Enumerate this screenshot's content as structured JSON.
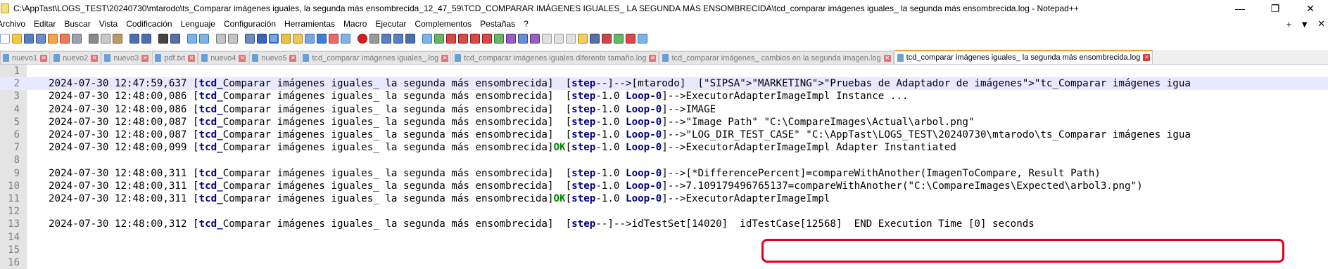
{
  "window": {
    "title": "C:\\AppTast\\LOGS_TEST\\20240730\\mtarodo\\ts_Comparar imágenes iguales, la segunda más ensombrecida_12_47_59\\TCD_COMPARAR IMÁGENES IGUALES_ LA SEGUNDA MÁS ENSOMBRECIDA\\tcd_comparar imágenes iguales_ la segunda más ensombrecida.log - Notepad++",
    "minimize": "—",
    "maximize": "❐",
    "close": "✕"
  },
  "menu": {
    "items": [
      "Archivo",
      "Editar",
      "Buscar",
      "Vista",
      "Codificación",
      "Lenguaje",
      "Configuración",
      "Herramientas",
      "Macro",
      "Ejecutar",
      "Complementos",
      "Pestañas",
      "?"
    ],
    "plus": "+",
    "dropdown": "▼",
    "close": "✕"
  },
  "tabs": [
    {
      "label": "nuevo1",
      "active": false
    },
    {
      "label": "nuevo2",
      "active": false
    },
    {
      "label": "nuevo3",
      "active": false
    },
    {
      "label": "pdf.txt",
      "active": false
    },
    {
      "label": "nuevo4",
      "active": false
    },
    {
      "label": "nuevo5",
      "active": false
    },
    {
      "label": "tcd_comparar imágenes iguales_.log",
      "active": false
    },
    {
      "label": "tcd_comparar imágenes iguales diferente tamaño.log",
      "active": false
    },
    {
      "label": "tcd_comparar imágenes_ cambios en la segunda imagen.log",
      "active": false
    },
    {
      "label": "tcd_comparar imágenes iguales_ la segunda más ensombrecida.log",
      "active": true
    }
  ],
  "editor": {
    "lines": [
      {
        "n": "1",
        "ts": "",
        "tag": "",
        "step": "",
        "rest": ""
      },
      {
        "n": "2",
        "ts": "2024-07-30 12:47:59,637 ",
        "tag": "Comparar imágenes iguales_ la segunda más ensombrecida]  ",
        "step": "--]-->[mtarodo]",
        "loop": "",
        "rest": "  [\"SIPSA\">\"MARKETING\">\"Pruebas de Adaptador de imágenes\">\"tc_Comparar imágenes igua"
      },
      {
        "n": "3",
        "ts": "2024-07-30 12:48:00,086 ",
        "tag": "Comparar imágenes iguales_ la segunda más ensombrecida]  ",
        "step": "-1.0 ",
        "loop": "Loop-0",
        "rest": "]-->ExecutorAdapterImageImpl Instance ..."
      },
      {
        "n": "4",
        "ts": "2024-07-30 12:48:00,086 ",
        "tag": "Comparar imágenes iguales_ la segunda más ensombrecida]  ",
        "step": "-1.0 ",
        "loop": "Loop-0",
        "rest": "]-->IMAGE"
      },
      {
        "n": "5",
        "ts": "2024-07-30 12:48:00,087 ",
        "tag": "Comparar imágenes iguales_ la segunda más ensombrecida]  ",
        "step": "-1.0 ",
        "loop": "Loop-0",
        "rest": "]-->\"Image Path\" \"C:\\CompareImages\\Actual\\arbol.png\""
      },
      {
        "n": "6",
        "ts": "2024-07-30 12:48:00,087 ",
        "tag": "Comparar imágenes iguales_ la segunda más ensombrecida]  ",
        "step": "-1.0 ",
        "loop": "Loop-0",
        "rest": "]-->\"LOG_DIR_TEST_CASE\" \"C:\\AppTast\\LOGS_TEST\\20240730\\mtarodo\\ts_Comparar imágenes igua"
      },
      {
        "n": "7",
        "ts": "2024-07-30 12:48:00,099 ",
        "tag": "Comparar imágenes iguales_ la segunda más ensombrecida]",
        "ok": "OK",
        "step": "-1.0 ",
        "loop": "Loop-0",
        "rest": "]-->ExecutorAdapterImageImpl Adapter Instantiated"
      },
      {
        "n": "8",
        "ts": "",
        "tag": "",
        "step": "",
        "rest": ""
      },
      {
        "n": "9",
        "ts": "2024-07-30 12:48:00,311 ",
        "tag": "Comparar imágenes iguales_ la segunda más ensombrecida]  ",
        "step": "-1.0 ",
        "loop": "Loop-0",
        "rest": "]-->[*DifferencePercent]=compareWithAnother(ImagenToCompare, Result Path)"
      },
      {
        "n": "10",
        "ts": "2024-07-30 12:48:00,311 ",
        "tag": "Comparar imágenes iguales_ la segunda más ensombrecida]  ",
        "step": "-1.0 ",
        "loop": "Loop-0",
        "rest": "]-->7.109179496765137=compareWithAnother(\"C:\\CompareImages\\Expected\\arbol3.png\")"
      },
      {
        "n": "11",
        "ts": "2024-07-30 12:48:00,311 ",
        "tag": "Comparar imágenes iguales_ la segunda más ensombrecida]",
        "ok": "OK",
        "step": "-1.0 ",
        "loop": "Loop-0",
        "rest": "]-->ExecutorAdapterImageImpl"
      },
      {
        "n": "12",
        "ts": "",
        "tag": "",
        "step": "",
        "rest": ""
      },
      {
        "n": "13",
        "ts": "2024-07-30 12:48:00,312 ",
        "tag": "Comparar imágenes iguales_ la segunda más ensombrecida]  ",
        "step": "--]-->idTestSet[14020]  idTestCase[12568]  END Execution Time [0] seconds",
        "loop": "",
        "rest": ""
      },
      {
        "n": "14",
        "ts": "",
        "tag": "",
        "step": "",
        "rest": ""
      },
      {
        "n": "15",
        "ts": "",
        "tag": "",
        "step": "",
        "rest": ""
      },
      {
        "n": "16",
        "ts": "",
        "tag": "",
        "step": "",
        "rest": ""
      }
    ],
    "tcd_prefix": "tcd_",
    "step_prefix": "step",
    "open_bracket": "[",
    "current_line": 2
  },
  "colors": {
    "keyword": "#000080",
    "ok": "#008000",
    "active_tab_accent": "#fa9d2c",
    "annotation_box": "#e0001a"
  }
}
